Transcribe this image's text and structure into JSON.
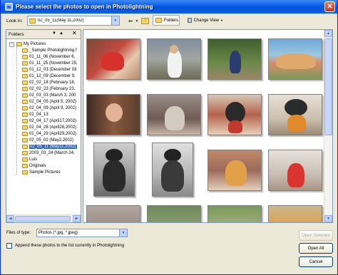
{
  "window": {
    "title": "Please select the photos to open in Photolightning"
  },
  "toolbar": {
    "look_in_label": "Look in:",
    "look_in_value": "02_05_11(May 11,2002)",
    "folders_label": "Folders",
    "change_view_label": "Change View"
  },
  "folders_panel": {
    "title": "Folders",
    "items": [
      {
        "label": "My Pictures"
      },
      {
        "label": "_Sample Photolightning f"
      },
      {
        "label": "01_11_06 (November 6,"
      },
      {
        "label": "01_11_25 (November 25,"
      },
      {
        "label": "01_12_03 (December 03"
      },
      {
        "label": "01_12_09 (December 9,"
      },
      {
        "label": "02_02_18 (February 18,"
      },
      {
        "label": "02_02_23 (February 23,"
      },
      {
        "label": "02_03_03 (March 3, 200"
      },
      {
        "label": "02_04_05 (April 5, 2002)"
      },
      {
        "label": "02_04_09 (April 9, 2002)"
      },
      {
        "label": "02_04_13"
      },
      {
        "label": "02_04_17 (April17,2002)"
      },
      {
        "label": "02_04_28 (April28,2002)"
      },
      {
        "label": "02_04_29 (April29,2002)"
      },
      {
        "label": "02_05_02 (May2,2002)"
      },
      {
        "label": "02_05_11 (May11,2002)"
      },
      {
        "label": "2003_03_24 (March 24,"
      },
      {
        "label": "Luis"
      },
      {
        "label": "Originals"
      },
      {
        "label": "Sample Pictures"
      }
    ]
  },
  "filetype": {
    "label": "Files of type:",
    "value": "Photos (*.jpg, *.jpeg)"
  },
  "append_label": "Append these photos to the list currently in Photolightning",
  "buttons": {
    "open_selected": "Open Selected",
    "open_all": "Open All",
    "cancel": "Cancel"
  },
  "icons": {
    "window": "photolightning-icon",
    "close": "close-icon",
    "back": "back-arrow-icon",
    "up": "up-folder-icon",
    "folder": "folder-icon"
  },
  "colors": {
    "title_bar": "#0a5ae6",
    "selection": "#316ac5",
    "panel_bg": "#ece9d8"
  }
}
